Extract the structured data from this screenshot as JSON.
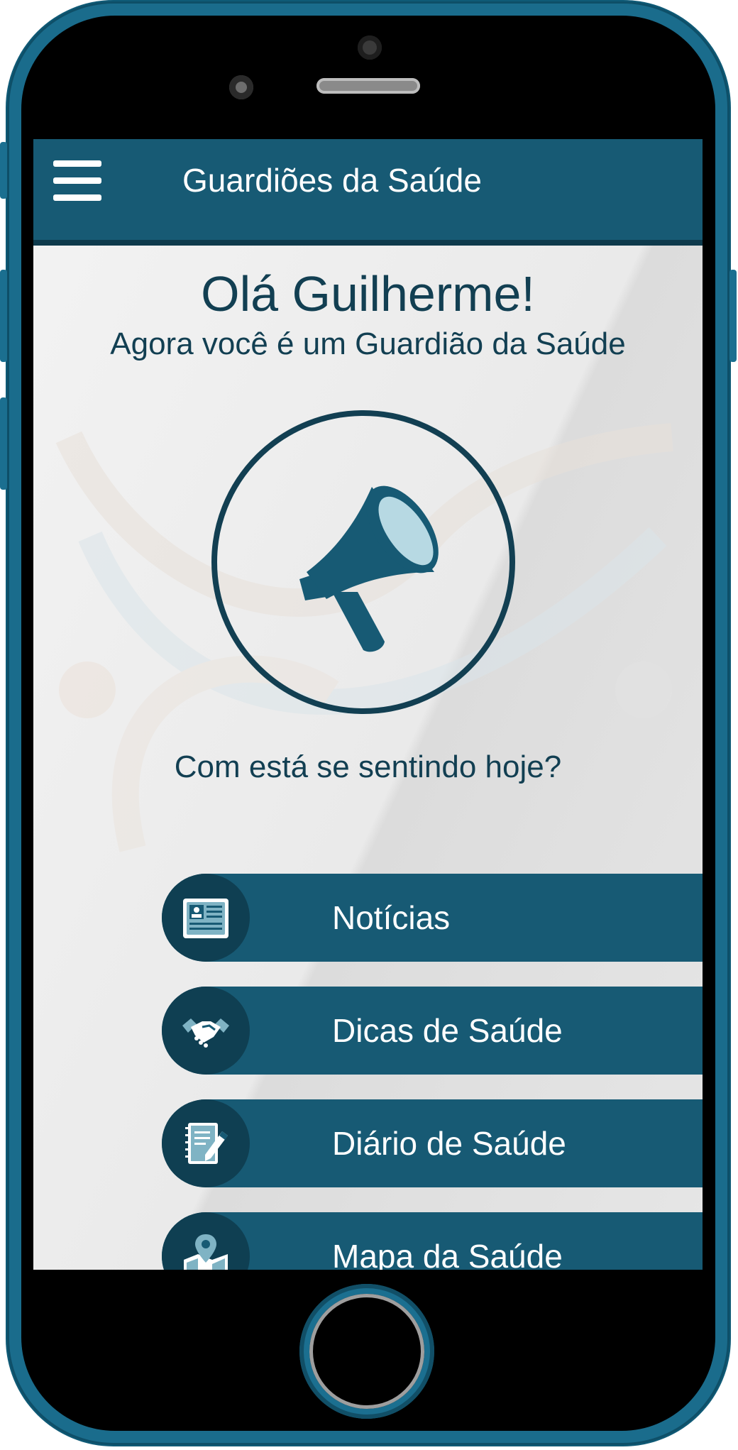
{
  "app": {
    "title": "Guardiões da Saúde"
  },
  "welcome": {
    "greeting": "Olá Guilherme!",
    "subtitle": "Agora você é um Guardião da Saúde"
  },
  "status": {
    "question": "Com está se sentindo hoje?",
    "icon": "megaphone-icon"
  },
  "menu": {
    "items": [
      {
        "label": "Notícias",
        "icon": "newspaper-icon"
      },
      {
        "label": "Dicas de Saúde",
        "icon": "handshake-icon"
      },
      {
        "label": "Diário de Saúde",
        "icon": "notebook-pencil-icon"
      },
      {
        "label": "Mapa da Saúde",
        "icon": "map-pin-icon"
      }
    ]
  },
  "colors": {
    "primary": "#175a74",
    "dark": "#0f3f52",
    "text": "#123f52",
    "background": "#eaeaea"
  }
}
